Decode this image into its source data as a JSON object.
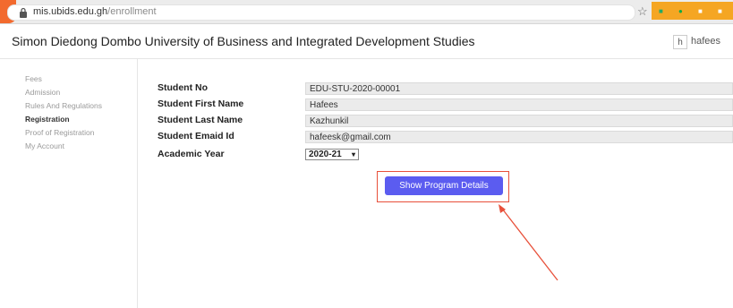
{
  "browser": {
    "url_domain": "mis.ubids.edu.gh",
    "url_path": "/enrollment"
  },
  "header": {
    "university_name": "Simon Diedong Dombo University of Business and Integrated Development Studies",
    "user_initial": "h",
    "user_name": "hafees"
  },
  "sidebar": {
    "items": [
      {
        "label": "Fees"
      },
      {
        "label": "Admission"
      },
      {
        "label": "Rules And Regulations"
      },
      {
        "label": "Registration"
      },
      {
        "label": "Proof of Registration"
      },
      {
        "label": "My Account"
      }
    ],
    "active_index": 3
  },
  "form": {
    "fields": [
      {
        "label": "Student No",
        "value": "EDU-STU-2020-00001"
      },
      {
        "label": "Student First Name",
        "value": "Hafees"
      },
      {
        "label": "Student Last Name",
        "value": "Kazhunkil"
      },
      {
        "label": "Student Emaid Id",
        "value": "hafeesk@gmail.com"
      }
    ],
    "academic_year_label": "Academic Year",
    "academic_year_value": "2020-21",
    "show_button_label": "Show Program Details"
  },
  "colors": {
    "button": "#5b5cf0",
    "annotation": "#e8503a",
    "tab_accent": "#f26a2e"
  }
}
